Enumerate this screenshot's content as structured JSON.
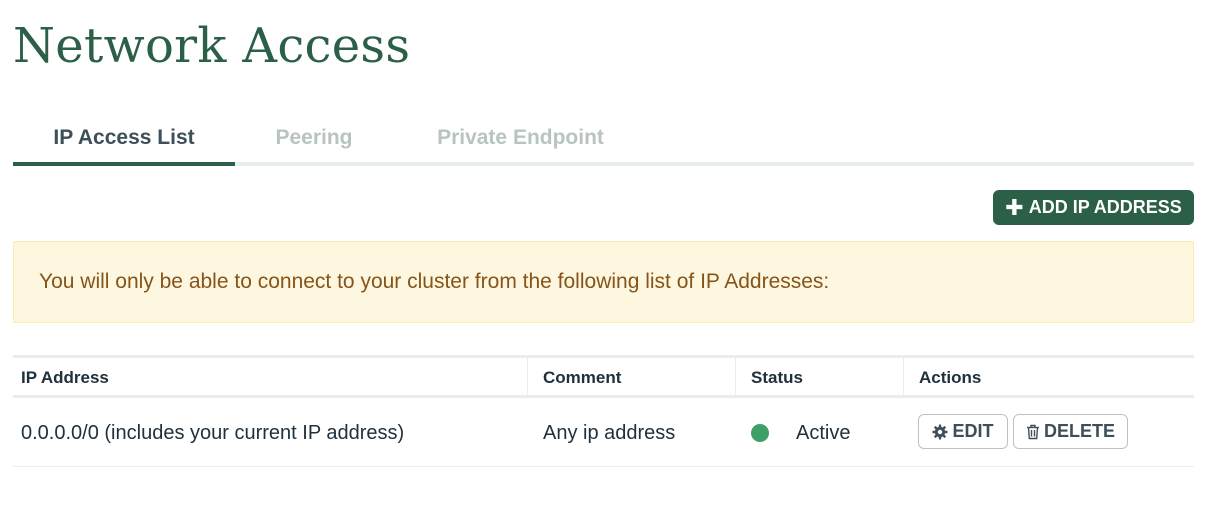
{
  "page": {
    "title": "Network Access"
  },
  "tabs": [
    {
      "label": "IP Access List",
      "active": true
    },
    {
      "label": "Peering",
      "active": false
    },
    {
      "label": "Private Endpoint",
      "active": false
    }
  ],
  "toolbar": {
    "add_label": "ADD IP ADDRESS",
    "add_icon": "plus-icon"
  },
  "banner": {
    "text": "You will only be able to connect to your cluster from the following list of IP Addresses:"
  },
  "table": {
    "columns": [
      "IP Address",
      "Comment",
      "Status",
      "Actions"
    ],
    "rows": [
      {
        "ip": "0.0.0.0/0  (includes your current IP address)",
        "comment": "Any ip address",
        "status": "Active",
        "actions": {
          "edit_label": "EDIT",
          "edit_icon": "gear-icon",
          "delete_label": "DELETE",
          "delete_icon": "trash-icon"
        }
      }
    ]
  },
  "colors": {
    "brand": "#2c5f47",
    "banner_bg": "#fef7e0",
    "banner_text": "#86541a",
    "status_active": "#3fa067",
    "tab_inactive": "#b8c4c2"
  }
}
